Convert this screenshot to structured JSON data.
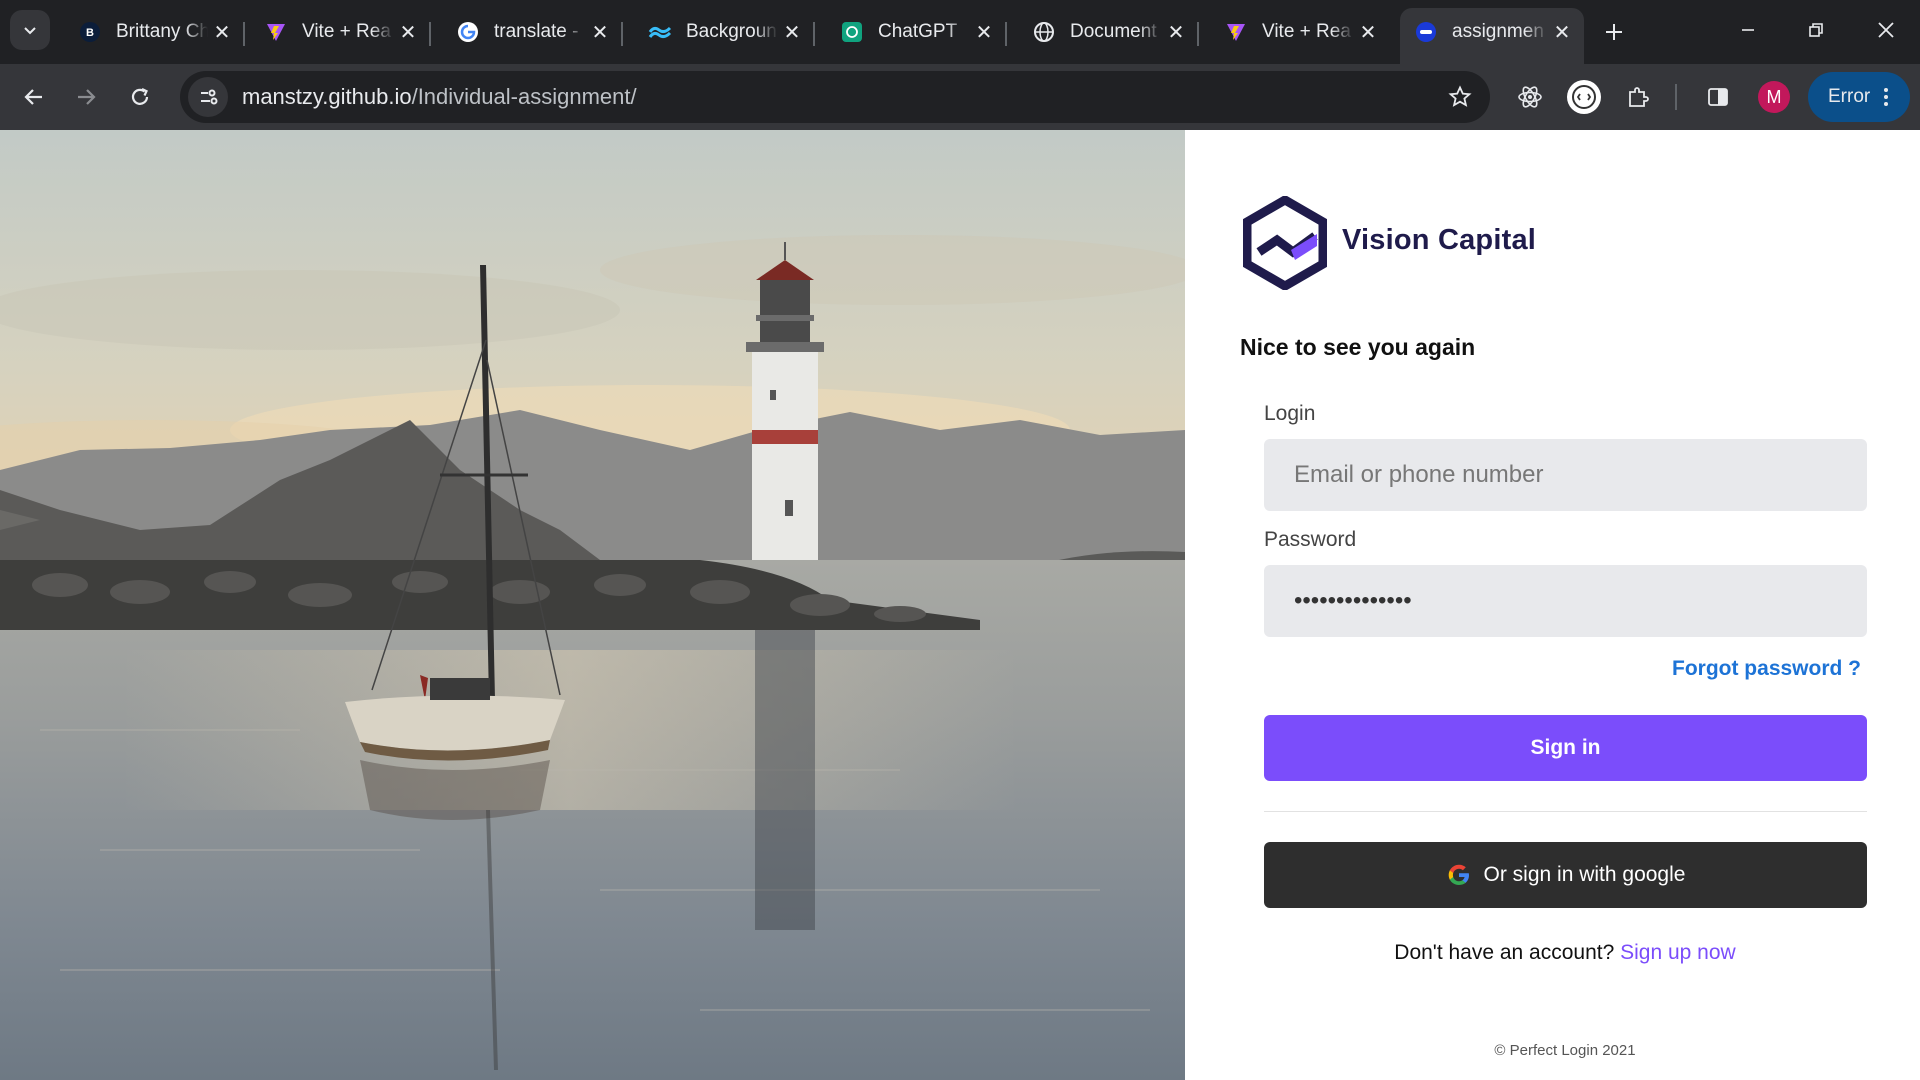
{
  "browser": {
    "tabs": [
      {
        "title": "Brittany Ch",
        "favicon": "letter-b-icon",
        "active": false
      },
      {
        "title": "Vite + Rea",
        "favicon": "vite-icon",
        "active": false
      },
      {
        "title": "translate -",
        "favicon": "google-icon",
        "active": false
      },
      {
        "title": "Backgroun",
        "favicon": "tailwind-icon",
        "active": false
      },
      {
        "title": "ChatGPT",
        "favicon": "chatgpt-icon",
        "active": false
      },
      {
        "title": "Document",
        "favicon": "globe-icon",
        "active": false
      },
      {
        "title": "Vite + Rea",
        "favicon": "vite-icon",
        "active": false
      },
      {
        "title": "assignmen",
        "favicon": "site-icon",
        "active": true
      }
    ],
    "url_host": "manstzy.github.io",
    "url_path": "/Individual-assignment/",
    "profile_initial": "M",
    "error_label": "Error"
  },
  "login": {
    "brand": "Vision Capital",
    "greeting": "Nice to see you again",
    "login_label": "Login",
    "login_placeholder": "Email or phone number",
    "password_label": "Password",
    "password_value": "••••••••••••••",
    "forgot": "Forgot password ?",
    "signin": "Sign in",
    "google": "Or sign in with google",
    "signup_prompt": "Don't have an account?",
    "signup_link": "Sign up now",
    "copyright": "© Perfect Login 2021"
  },
  "colors": {
    "accent": "#7b4dfb",
    "link": "#1d73d6",
    "brand_navy": "#1f1b4b",
    "google_button": "#2e2e2e"
  }
}
